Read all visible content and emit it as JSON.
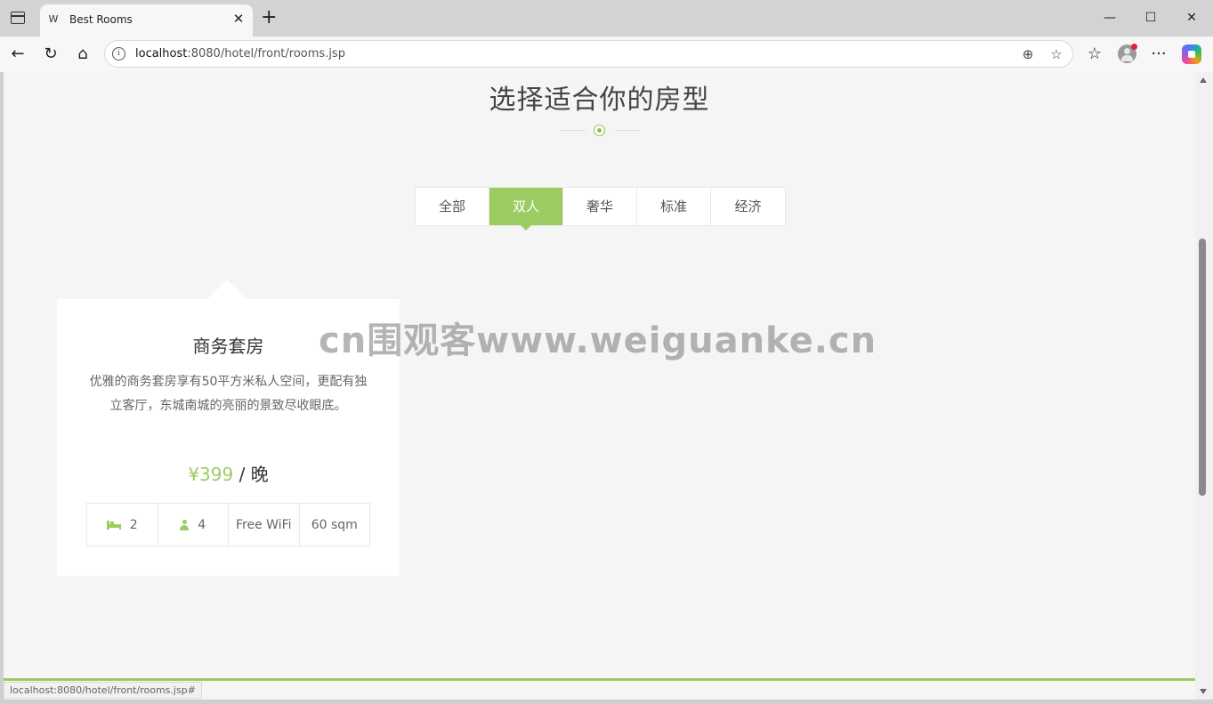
{
  "browser": {
    "tab_title": "Best Rooms",
    "tab_favicon": "W",
    "tab_close": "✕",
    "new_tab": "+",
    "url_host": "localhost",
    "url_rest": ":8080/hotel/front/rooms.jsp",
    "info_icon": "i",
    "status_url": "localhost:8080/hotel/front/rooms.jsp#"
  },
  "window_controls": {
    "minimize": "—",
    "maximize": "☐",
    "close": "✕"
  },
  "nav_icons": {
    "back": "←",
    "reload": "↻",
    "home": "⌂",
    "zoom": "⊕",
    "favorite": "☆",
    "favorites_list": "☆",
    "more": "···"
  },
  "page": {
    "section_title": "选择适合你的房型",
    "filters": [
      {
        "label": "全部",
        "active": false
      },
      {
        "label": "双人",
        "active": true
      },
      {
        "label": "奢华",
        "active": false
      },
      {
        "label": "标准",
        "active": false
      },
      {
        "label": "经济",
        "active": false
      }
    ],
    "room": {
      "title": "商务套房",
      "description": "优雅的商务套房享有50平方米私人空间，更配有独立客厅，东城南城的亮丽的景致尽收眼底。",
      "price": "¥399",
      "price_unit": " / 晚",
      "beds": "2",
      "guests": "4",
      "wifi": "Free WiFi",
      "size": "60 sqm"
    },
    "watermark": "cn围观客www.weiguanke.cn"
  },
  "colors": {
    "accent": "#9ccb62",
    "background": "#f5f5f5"
  }
}
